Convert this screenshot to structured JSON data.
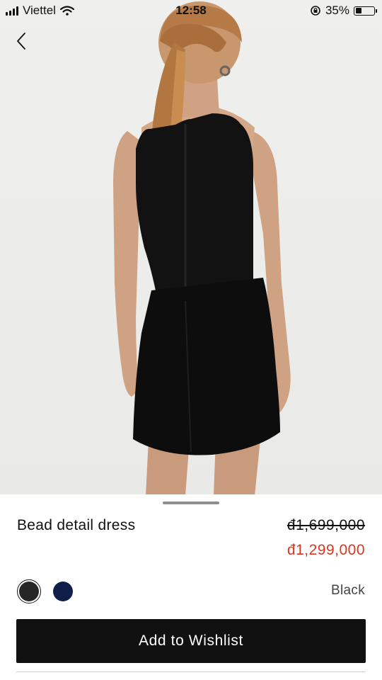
{
  "status_bar": {
    "carrier": "Viettel",
    "time": "12:58",
    "battery_percent": "35%",
    "battery_level": 0.35,
    "icons": [
      "signal-icon",
      "wifi-icon",
      "orientation-lock-icon",
      "battery-icon"
    ]
  },
  "navigation": {
    "back_icon": "chevron-left-icon"
  },
  "product": {
    "name": "Bead detail dress",
    "original_price": "đ1,699,000",
    "sale_price": "đ1,299,000",
    "selected_color": "Black",
    "swatches": [
      {
        "color": "#262626",
        "selected": true
      },
      {
        "color": "#0f1f4a",
        "selected": false
      }
    ]
  },
  "actions": {
    "wishlist_label": "Add to Wishlist"
  },
  "colors": {
    "sale_price": "#d9361f",
    "button_background": "#111111",
    "photo_background": "#efefed"
  }
}
